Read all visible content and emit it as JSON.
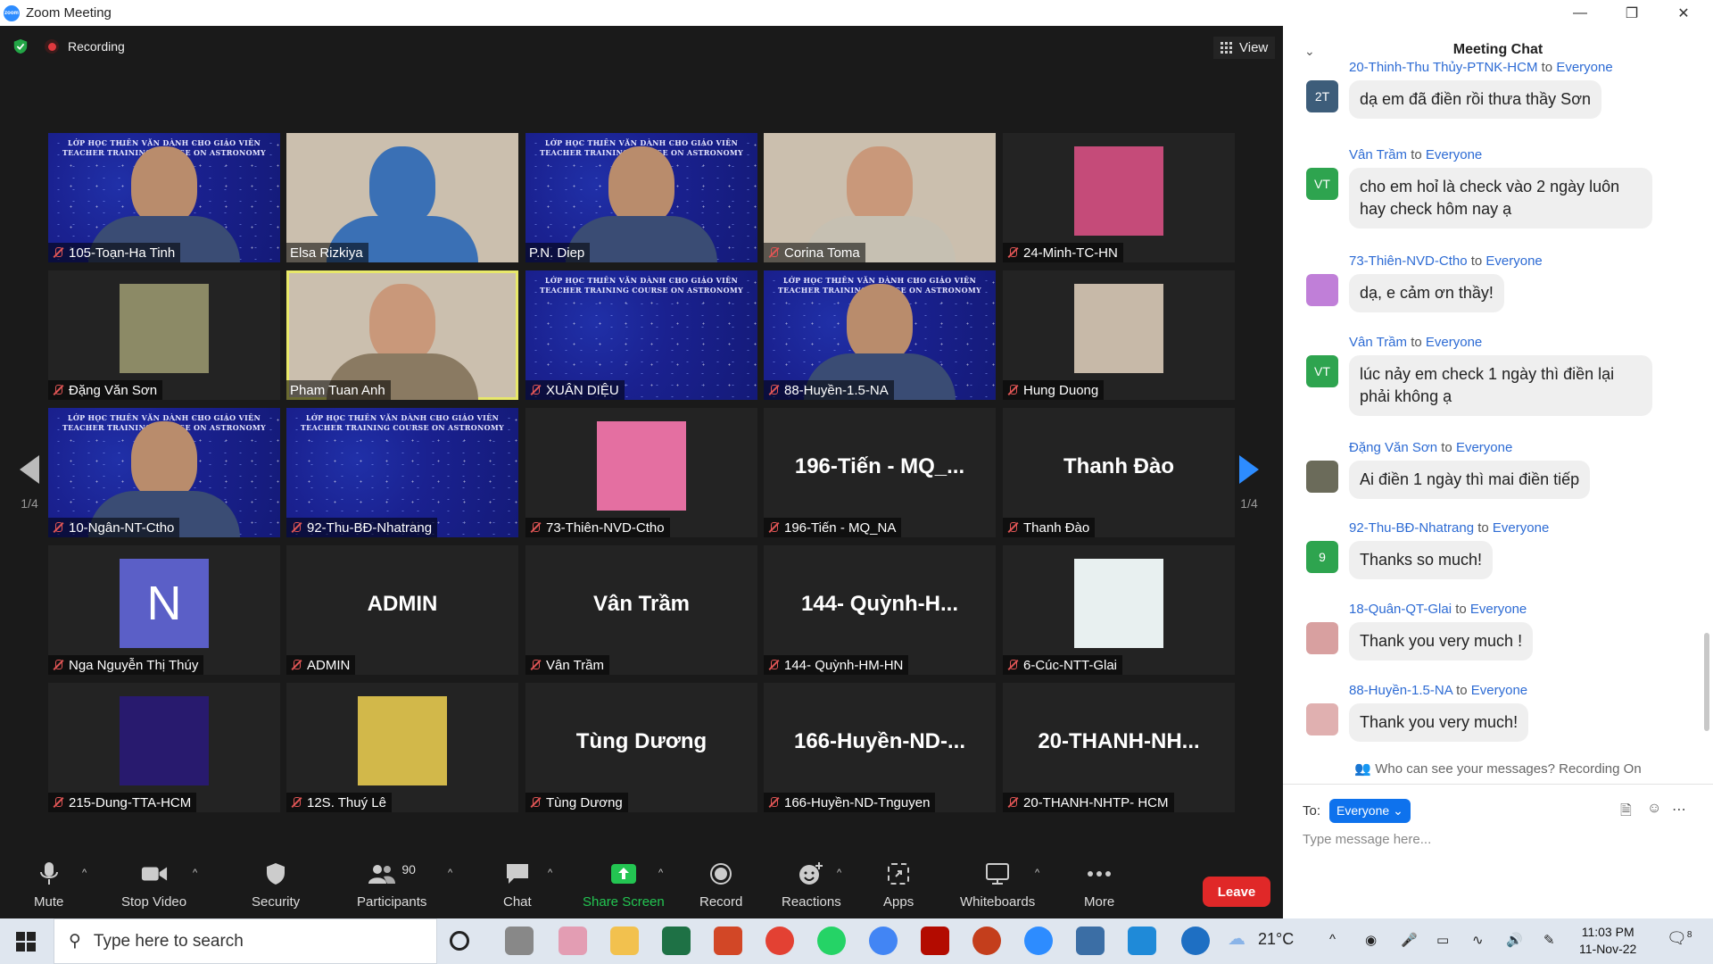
{
  "window": {
    "title": "Zoom Meeting",
    "logo_text": "zoom",
    "controls": [
      "—",
      "❐",
      "✕"
    ]
  },
  "meeting": {
    "recording_label": "Recording",
    "view_label": "View",
    "pager_left": "1/4",
    "pager_right": "1/4",
    "banner_text": "LỚP HỌC THIÊN VĂN DÀNH CHO GIÁO VIÊN\nTEACHER TRAINING COURSE ON ASTRONOMY"
  },
  "tiles": [
    {
      "name": "105-Toạn-Ha Tinh",
      "kind": "video-blue",
      "muted": true
    },
    {
      "name": "Elsa Rizkiya",
      "kind": "video",
      "muted": false
    },
    {
      "name": "P.N. Diep",
      "kind": "video-blue",
      "muted": false
    },
    {
      "name": "Corina Toma",
      "kind": "video",
      "muted": true
    },
    {
      "name": "24-Minh-TC-HN",
      "kind": "photo",
      "muted": true
    },
    {
      "name": "Đặng Văn Sơn",
      "kind": "photo",
      "muted": true
    },
    {
      "name": "Pham Tuan Anh",
      "kind": "video",
      "muted": false,
      "active": true
    },
    {
      "name": "XUÂN DIỆU",
      "kind": "video-blue",
      "muted": true
    },
    {
      "name": "88-Huyền-1.5-NA",
      "kind": "video-blue",
      "muted": true
    },
    {
      "name": "Hung Duong",
      "kind": "photo",
      "muted": true
    },
    {
      "name": "10-Ngân-NT-Ctho",
      "kind": "video-blue",
      "muted": true
    },
    {
      "name": "92-Thu-BĐ-Nhatrang",
      "kind": "video-blue",
      "muted": true
    },
    {
      "name": "73-Thiên-NVD-Ctho",
      "kind": "photo",
      "muted": true
    },
    {
      "name": "196-Tiến - MQ_NA",
      "kind": "text",
      "big": "196-Tiến  -  MQ_...",
      "muted": true
    },
    {
      "name": "Thanh Đào",
      "kind": "text",
      "big": "Thanh Đào",
      "muted": true
    },
    {
      "name": "Nga Nguyễn Thị Thúy",
      "kind": "letter",
      "big": "N",
      "muted": true
    },
    {
      "name": "ADMIN",
      "kind": "text",
      "big": "ADMIN",
      "muted": true
    },
    {
      "name": "Vân Trầm",
      "kind": "text",
      "big": "Vân Trầm",
      "muted": true
    },
    {
      "name": "144- Quỳnh-HM-HN",
      "kind": "text",
      "big": "144-  Quỳnh-H...",
      "muted": true
    },
    {
      "name": "6-Cúc-NTT-Glai",
      "kind": "photo",
      "muted": true
    },
    {
      "name": "215-Dung-TTA-HCM",
      "kind": "photo",
      "muted": true
    },
    {
      "name": "12S. Thuý Lê",
      "kind": "photo",
      "muted": true
    },
    {
      "name": "Tùng Dương",
      "kind": "text",
      "big": "Tùng Dương",
      "muted": true
    },
    {
      "name": "166-Huyền-ND-Tnguyen",
      "kind": "text",
      "big": "166-Huyền-ND-...",
      "muted": true
    },
    {
      "name": "20-THANH-NHTP- HCM",
      "kind": "text",
      "big": "20-THANH-NH...",
      "muted": true
    }
  ],
  "toolbar": {
    "mute": "Mute",
    "stop_video": "Stop Video",
    "security": "Security",
    "participants": "Participants",
    "participants_count": "90",
    "chat": "Chat",
    "share_screen": "Share Screen",
    "record": "Record",
    "reactions": "Reactions",
    "apps": "Apps",
    "whiteboards": "Whiteboards",
    "more": "More",
    "leave": "Leave"
  },
  "chat": {
    "title": "Meeting Chat",
    "messages": [
      {
        "from": "20-Thinh-Thu Thủy-PTNK-HCM",
        "to": "Everyone",
        "text": "dạ em đã điền rồi thưa thầy Sơn",
        "avatar": "2T",
        "avatar_color": "#3d5d7a"
      },
      {
        "from": "Vân Trầm",
        "to": "Everyone",
        "text": "cho em hoỉ là check vào 2 ngày luôn hay check hôm nay ạ",
        "avatar": "VT",
        "avatar_color": "#2ea44f"
      },
      {
        "from": "73-Thiên-NVD-Ctho",
        "to": "Everyone",
        "text": "dạ, e cảm ơn thầy!",
        "avatar": "",
        "avatar_color": "#c07fd8"
      },
      {
        "from": "Vân Trầm",
        "to": "Everyone",
        "text": "lúc nảy em check 1 ngày thì điền lại phải không ạ",
        "avatar": "VT",
        "avatar_color": "#2ea44f"
      },
      {
        "from": "Đặng Văn Sơn",
        "to": "Everyone",
        "text": "Ai điền 1 ngày thì mai điền tiếp",
        "avatar": "",
        "avatar_color": "#6b6b5a"
      },
      {
        "from": "92-Thu-BĐ-Nhatrang",
        "to": "Everyone",
        "text": "Thanks so much!",
        "avatar": "9",
        "avatar_color": "#2ea44f"
      },
      {
        "from": "18-Quân-QT-Glai",
        "to": "Everyone",
        "text": "Thank you very much !",
        "avatar": "",
        "avatar_color": "#d8a0a0"
      },
      {
        "from": "88-Huyền-1.5-NA",
        "to": "Everyone",
        "text": "Thank you very much!",
        "avatar": "",
        "avatar_color": "#e0b0b0"
      }
    ],
    "to_word": "to",
    "who_can_see": "Who can see your messages? Recording On",
    "to_label": "To:",
    "to_value": "Everyone",
    "placeholder": "Type message here..."
  },
  "taskbar": {
    "search_placeholder": "Type here to search",
    "weather": "21°C",
    "time": "11:03 PM",
    "date": "11-Nov-22",
    "notif_count": "8"
  }
}
